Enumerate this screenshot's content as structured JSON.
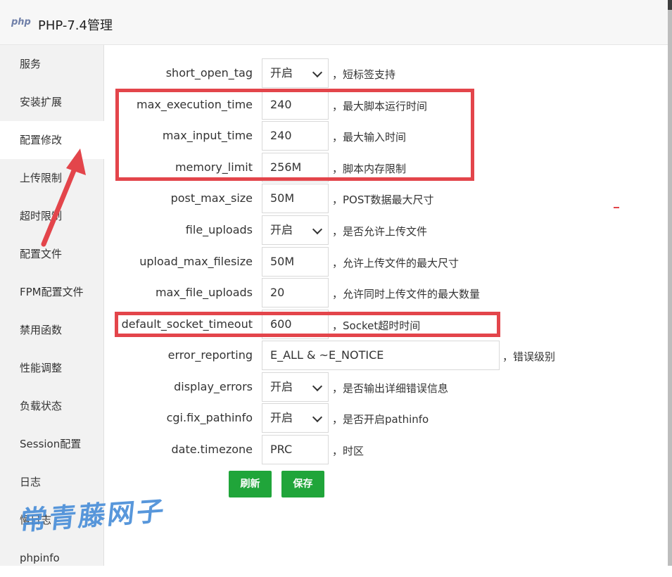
{
  "window": {
    "logo_text": "php",
    "title": "PHP-7.4管理"
  },
  "sidebar": {
    "items": [
      {
        "label": "服务"
      },
      {
        "label": "安装扩展"
      },
      {
        "label": "配置修改",
        "active": true
      },
      {
        "label": "上传限制"
      },
      {
        "label": "超时限制"
      },
      {
        "label": "配置文件"
      },
      {
        "label": "FPM配置文件"
      },
      {
        "label": "禁用函数"
      },
      {
        "label": "性能调整"
      },
      {
        "label": "负载状态"
      },
      {
        "label": "Session配置"
      },
      {
        "label": "日志"
      },
      {
        "label": "慢日志"
      },
      {
        "label": "phpinfo"
      }
    ]
  },
  "settings": [
    {
      "key": "short_open_tag",
      "type": "select",
      "value": "开启",
      "desc": "，短标签支持"
    },
    {
      "key": "max_execution_time",
      "type": "input",
      "value": "240",
      "desc": "，最大脚本运行时间"
    },
    {
      "key": "max_input_time",
      "type": "input",
      "value": "240",
      "desc": "，最大输入时间"
    },
    {
      "key": "memory_limit",
      "type": "input",
      "value": "256M",
      "desc": "，脚本内存限制"
    },
    {
      "key": "post_max_size",
      "type": "input",
      "value": "50M",
      "desc": "，POST数据最大尺寸"
    },
    {
      "key": "file_uploads",
      "type": "select",
      "value": "开启",
      "desc": "，是否允许上传文件"
    },
    {
      "key": "upload_max_filesize",
      "type": "input",
      "value": "50M",
      "desc": "，允许上传文件的最大尺寸"
    },
    {
      "key": "max_file_uploads",
      "type": "input",
      "value": "20",
      "desc": "，允许同时上传文件的最大数量"
    },
    {
      "key": "default_socket_timeout",
      "type": "input",
      "value": "600",
      "desc": "，Socket超时时间"
    },
    {
      "key": "error_reporting",
      "type": "input-wide",
      "value": "E_ALL & ~E_NOTICE",
      "desc": "，错误级别"
    },
    {
      "key": "display_errors",
      "type": "select",
      "value": "开启",
      "desc": "，是否输出详细错误信息"
    },
    {
      "key": "cgi.fix_pathinfo",
      "type": "select",
      "value": "开启",
      "desc": "，是否开启pathinfo"
    },
    {
      "key": "date.timezone",
      "type": "input",
      "value": "PRC",
      "desc": "，时区"
    }
  ],
  "buttons": {
    "refresh": "刷新",
    "save": "保存"
  },
  "watermark": "常青藤网子",
  "colors": {
    "accent_green": "#20a53a",
    "highlight_red": "#e3454b",
    "watermark_blue": "#4a8fd9"
  }
}
